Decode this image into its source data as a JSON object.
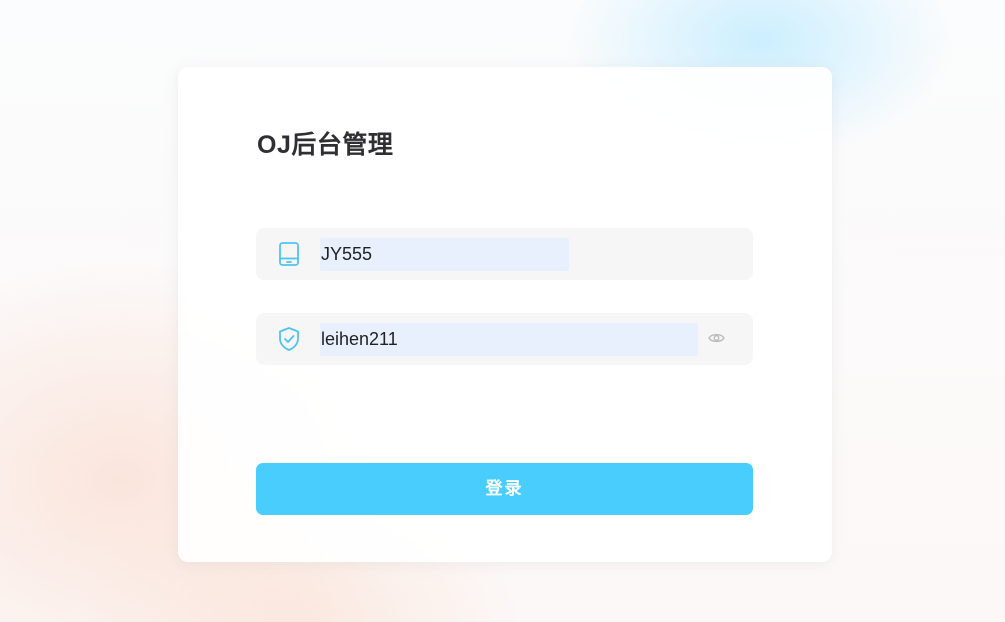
{
  "login": {
    "title": "OJ后台管理",
    "username": {
      "value": "JY555",
      "icon": "tablet-icon"
    },
    "password": {
      "value": "leihen211",
      "icon": "shield-check-icon",
      "toggle_icon": "eye-icon"
    },
    "submit_label": "登录"
  },
  "colors": {
    "accent": "#48cdfd",
    "icon": "#4fc3ef",
    "field_bg": "#f6f6f7",
    "autofill_bg": "#e8f0fe",
    "title": "#2f2f33"
  }
}
